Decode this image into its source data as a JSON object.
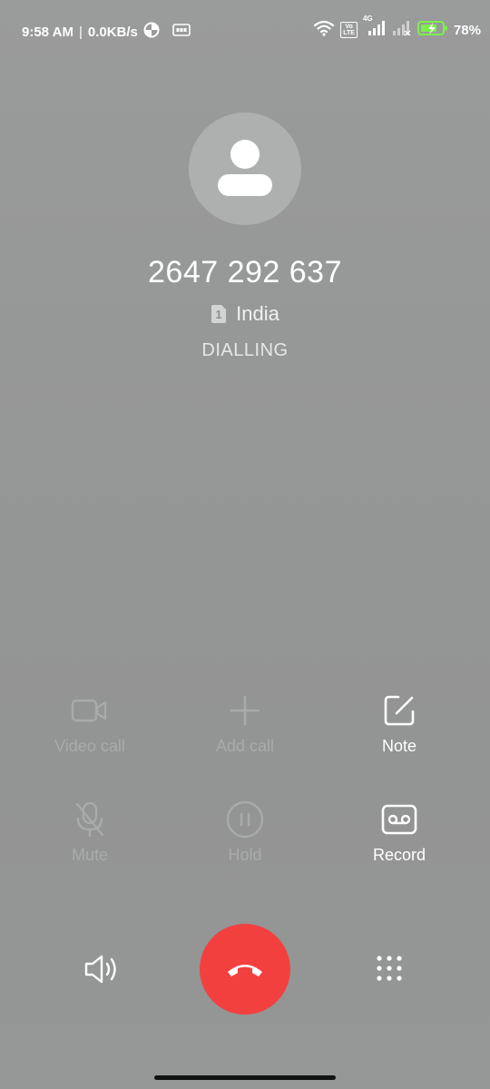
{
  "status_bar": {
    "time": "9:58 AM",
    "separator": "|",
    "network_speed": "0.0KB/s",
    "network_type": "4G",
    "volte_line1": "Vo",
    "volte_line2": "LTE",
    "battery_percent": "78%",
    "icons": [
      "data-saver-icon",
      "gps-icon",
      "wifi-icon",
      "volte-icon",
      "signal-icon",
      "signal-weak-icon",
      "battery-charging-icon"
    ]
  },
  "caller": {
    "number": "2647 292 637",
    "sim_slot": "1",
    "location": "India",
    "status": "DIALLING"
  },
  "controls": {
    "video_call": {
      "label": "Video call",
      "icon": "video-camera-icon",
      "enabled": false
    },
    "add_call": {
      "label": "Add call",
      "icon": "plus-icon",
      "enabled": false
    },
    "note": {
      "label": "Note",
      "icon": "note-edit-icon",
      "enabled": true
    },
    "mute": {
      "label": "Mute",
      "icon": "microphone-off-icon",
      "enabled": false
    },
    "hold": {
      "label": "Hold",
      "icon": "pause-icon",
      "enabled": false
    },
    "record": {
      "label": "Record",
      "icon": "record-tape-icon",
      "enabled": true
    }
  },
  "bottom_bar": {
    "speaker_icon": "speaker-icon",
    "end_call_icon": "phone-hangup-icon",
    "keypad_icon": "dialpad-icon"
  },
  "colors": {
    "background": "#939595",
    "end_call": "#f2403f",
    "enabled_text": "#ffffff",
    "disabled_text": "#a9abab"
  }
}
